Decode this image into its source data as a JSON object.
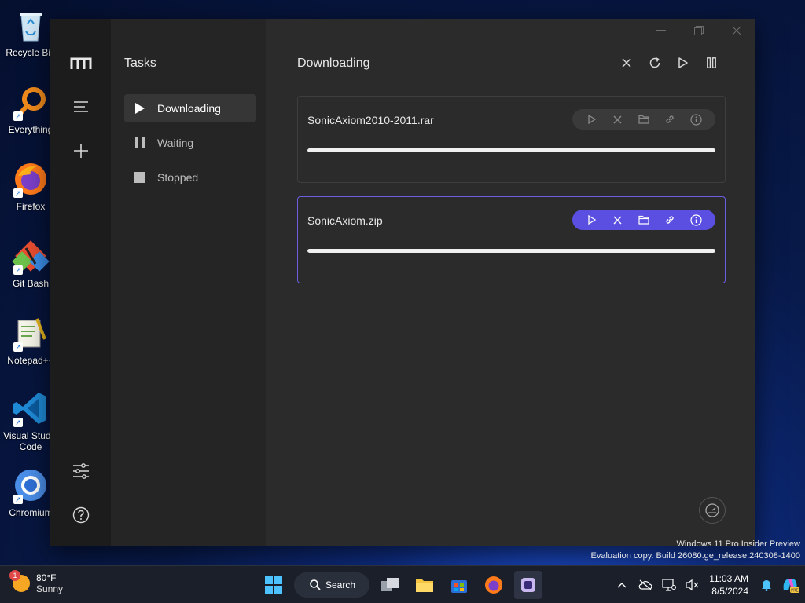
{
  "desktop": {
    "icons": [
      {
        "label": "Recycle Bin",
        "icon": "recycle-bin-icon"
      },
      {
        "label": "Everything",
        "icon": "everything-icon"
      },
      {
        "label": "Firefox",
        "icon": "firefox-icon"
      },
      {
        "label": "Git Bash",
        "icon": "git-bash-icon"
      },
      {
        "label": "Notepad++",
        "icon": "notepad-plus-plus-icon"
      },
      {
        "label": "Visual Studio Code",
        "icon": "vscode-icon"
      },
      {
        "label": "Chromium",
        "icon": "chromium-icon"
      }
    ]
  },
  "app": {
    "sidebar": {
      "title": "Tasks",
      "items": [
        {
          "label": "Downloading",
          "icon": "play-icon",
          "active": true
        },
        {
          "label": "Waiting",
          "icon": "pause-icon",
          "active": false
        },
        {
          "label": "Stopped",
          "icon": "stop-icon",
          "active": false
        }
      ]
    },
    "main": {
      "heading": "Downloading",
      "tasks": [
        {
          "name": "SonicAxiom2010-2011.rar",
          "progress": 1.0
        },
        {
          "name": "SonicAxiom.zip",
          "progress": 1.0
        }
      ]
    }
  },
  "watermark": {
    "line1": "Windows 11 Pro Insider Preview",
    "line2": "Evaluation copy. Build 26080.ge_release.240308-1400"
  },
  "taskbar": {
    "weather": {
      "temp": "80°F",
      "condition": "Sunny",
      "badge": "1"
    },
    "search_label": "Search",
    "clock": {
      "time": "11:03 AM",
      "date": "8/5/2024"
    }
  },
  "colors": {
    "accent": "#5a4fe0",
    "rail": "#1c1c1c",
    "sidebar": "#252525",
    "main": "#2b2b2b"
  }
}
